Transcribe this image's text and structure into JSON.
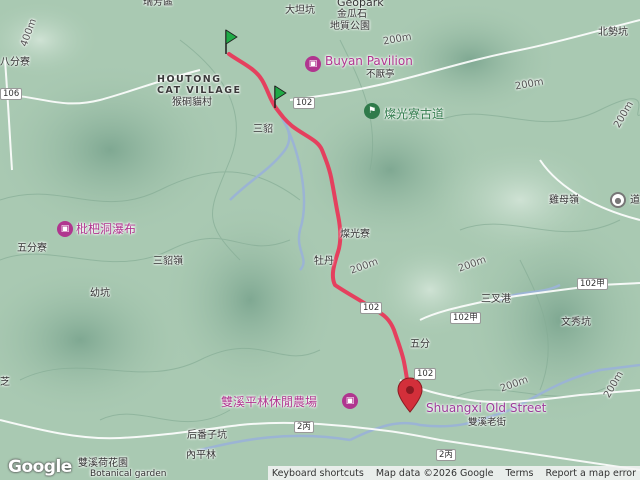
{
  "map": {
    "labels": [
      {
        "name": "label-ruifang-district",
        "text": "瑞芳區"
      },
      {
        "name": "label-dachukeng",
        "text": "大坦坑"
      },
      {
        "name": "label-geopark-en",
        "text": "Geopark"
      },
      {
        "name": "label-jinguashi",
        "text": "金瓜石"
      },
      {
        "name": "label-geopark-zh",
        "text": "地質公園"
      },
      {
        "name": "label-baliaoliao",
        "text": "八分寮"
      },
      {
        "name": "label-beishihkeng",
        "text": "北勢坑"
      },
      {
        "name": "label-houtong-en",
        "text": "HOUTONG\nCAT VILLAGE"
      },
      {
        "name": "label-houtong-zh",
        "text": "猴硐貓村"
      },
      {
        "name": "label-buyan-en",
        "text": "Buyan Pavilion"
      },
      {
        "name": "label-buyan-zh",
        "text": "不厭亭"
      },
      {
        "name": "label-canguangliao-trail",
        "text": "燦光寮古道"
      },
      {
        "name": "label-sandiao",
        "text": "三貂"
      },
      {
        "name": "label-pipadong",
        "text": "枇杷洞瀑布"
      },
      {
        "name": "label-wufenliao",
        "text": "五分寮"
      },
      {
        "name": "label-canguangliao",
        "text": "燦光寮"
      },
      {
        "name": "label-sandiaoling",
        "text": "三貂嶺"
      },
      {
        "name": "label-mudan",
        "text": "牡丹"
      },
      {
        "name": "label-leimuling",
        "text": "雞母嶺"
      },
      {
        "name": "label-youkeng",
        "text": "幼坑"
      },
      {
        "name": "label-sanchagang",
        "text": "三叉港"
      },
      {
        "name": "label-wenxiukeng",
        "text": "文秀坑"
      },
      {
        "name": "label-wufen",
        "text": "五分"
      },
      {
        "name": "label-shuangxi-farm",
        "text": "雙溪平林休閒農場"
      },
      {
        "name": "label-shuangxi-en",
        "text": "Shuangxi Old Street"
      },
      {
        "name": "label-shuangxi-zh",
        "text": "雙溪老街"
      },
      {
        "name": "label-houfanzikeng",
        "text": "后番子坑"
      },
      {
        "name": "label-neipinglin",
        "text": "內平林"
      },
      {
        "name": "label-lotus-zh",
        "text": "雙溪荷花園"
      },
      {
        "name": "label-lotus-en",
        "text": "Botanical garden"
      },
      {
        "name": "label-zhi",
        "text": "芝"
      },
      {
        "name": "label-dao",
        "text": "道"
      }
    ],
    "elevations": [
      "200m",
      "200m",
      "200m",
      "400m",
      "200m",
      "200m",
      "200m",
      "200m"
    ],
    "road_shields": [
      "106",
      "102",
      "102",
      "102甲",
      "102甲",
      "102",
      "2丙",
      "2丙"
    ],
    "colors": {
      "route": "#e8395a",
      "terrain": "#a9c9b2",
      "river": "#9bb4d4",
      "road": "#ffffff"
    }
  },
  "attribution": {
    "google": "Google",
    "shortcuts": "Keyboard shortcuts",
    "data": "Map data ©2026 Google",
    "terms": "Terms",
    "report": "Report a map error"
  }
}
